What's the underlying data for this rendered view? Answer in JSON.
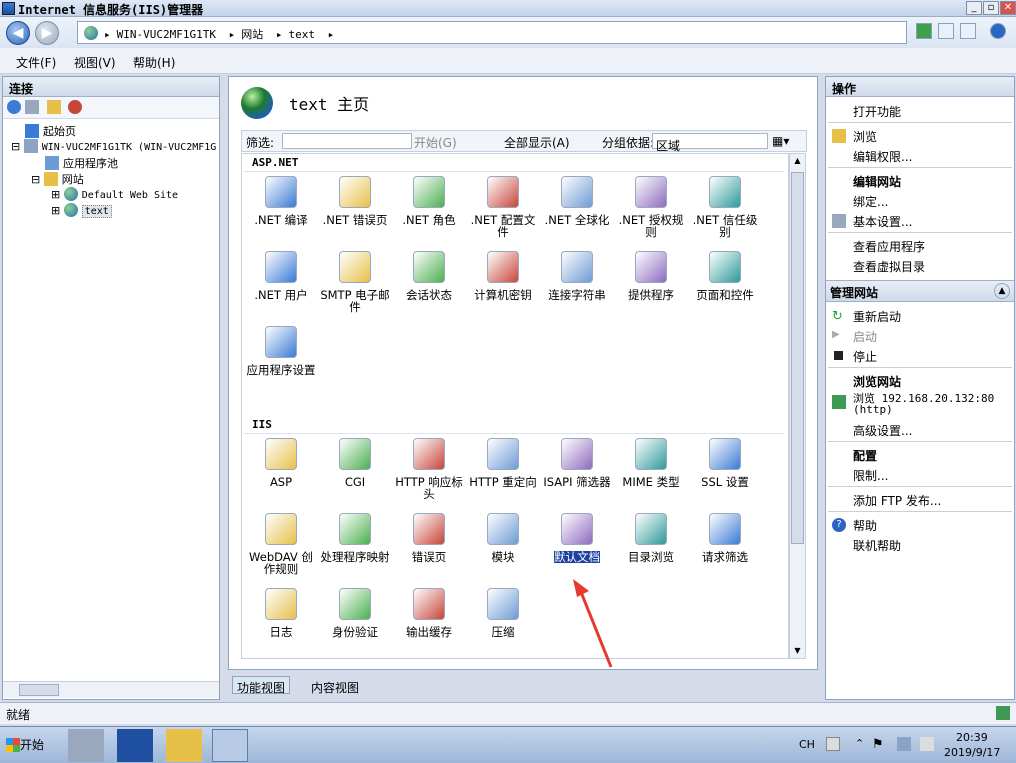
{
  "window": {
    "title": "Internet 信息服务(IIS)管理器"
  },
  "address": {
    "crumbs": [
      "WIN-VUC2MF1G1TK",
      "网站",
      "text"
    ]
  },
  "menu": [
    "文件(F)",
    "视图(V)",
    "帮助(H)"
  ],
  "left_pane": {
    "header": "连接",
    "tree": [
      {
        "label": "起始页"
      },
      {
        "label": "WIN-VUC2MF1G1TK (WIN-VUC2MF1G"
      },
      {
        "label": "应用程序池"
      },
      {
        "label": "网站"
      },
      {
        "label": "Default Web Site"
      },
      {
        "label": "text"
      }
    ]
  },
  "center": {
    "title": "text 主页",
    "filter": {
      "label": "筛选:",
      "start": "开始(G)",
      "show_all": "全部显示(A)",
      "group_by": "分组依据:",
      "group_value": "区域"
    },
    "sections": [
      {
        "name": "ASP.NET",
        "items": [
          {
            "label": ".NET 编译",
            "icon": "dotnet-compile-icon"
          },
          {
            "label": ".NET 错误页",
            "icon": "error-404-icon"
          },
          {
            "label": ".NET 角色",
            "icon": "roles-icon"
          },
          {
            "label": ".NET 配置文件",
            "icon": "profile-icon"
          },
          {
            "label": ".NET 全球化",
            "icon": "globalization-icon"
          },
          {
            "label": ".NET 授权规则",
            "icon": "authorization-icon"
          },
          {
            "label": ".NET 信任级别",
            "icon": "trust-level-icon"
          },
          {
            "label": ".NET 用户",
            "icon": "users-icon"
          },
          {
            "label": "SMTP 电子邮件",
            "icon": "smtp-email-icon"
          },
          {
            "label": "会话状态",
            "icon": "session-state-icon"
          },
          {
            "label": "计算机密钥",
            "icon": "machine-key-icon"
          },
          {
            "label": "连接字符串",
            "icon": "connection-strings-icon"
          },
          {
            "label": "提供程序",
            "icon": "providers-icon"
          },
          {
            "label": "页面和控件",
            "icon": "pages-controls-icon"
          },
          {
            "label": "应用程序设置",
            "icon": "app-settings-icon"
          }
        ]
      },
      {
        "name": "IIS",
        "items": [
          {
            "label": "ASP",
            "icon": "asp-icon"
          },
          {
            "label": "CGI",
            "icon": "cgi-icon"
          },
          {
            "label": "HTTP 响应标头",
            "icon": "http-response-headers-icon"
          },
          {
            "label": "HTTP 重定向",
            "icon": "http-redirect-icon"
          },
          {
            "label": "ISAPI 筛选器",
            "icon": "isapi-filters-icon"
          },
          {
            "label": "MIME 类型",
            "icon": "mime-types-icon"
          },
          {
            "label": "SSL 设置",
            "icon": "ssl-lock-icon"
          },
          {
            "label": "WebDAV 创作规则",
            "icon": "webdav-icon"
          },
          {
            "label": "处理程序映射",
            "icon": "handler-mappings-icon"
          },
          {
            "label": "错误页",
            "icon": "error-pages-icon"
          },
          {
            "label": "模块",
            "icon": "modules-icon"
          },
          {
            "label": "默认文档",
            "icon": "default-document-icon"
          },
          {
            "label": "目录浏览",
            "icon": "directory-browsing-icon"
          },
          {
            "label": "请求筛选",
            "icon": "request-filtering-icon"
          },
          {
            "label": "日志",
            "icon": "logging-icon"
          },
          {
            "label": "身份验证",
            "icon": "authentication-icon"
          },
          {
            "label": "输出缓存",
            "icon": "output-caching-icon"
          },
          {
            "label": "压缩",
            "icon": "compression-icon"
          }
        ]
      }
    ],
    "tabs": [
      "功能视图",
      "内容视图"
    ]
  },
  "right_pane": {
    "header": "操作",
    "open_feature": "打开功能",
    "browse": "浏览",
    "edit_perms": "编辑权限...",
    "edit_site_hdr": "编辑网站",
    "bindings": "绑定...",
    "basic_settings": "基本设置...",
    "view_apps": "查看应用程序",
    "view_vdirs": "查看虚拟目录",
    "manage_site_hdr": "管理网站",
    "restart": "重新启动",
    "start": "启动",
    "stop": "停止",
    "browse_site_hdr": "浏览网站",
    "browse_url": "浏览 192.168.20.132:80",
    "browse_proto": "(http)",
    "advanced": "高级设置...",
    "config_hdr": "配置",
    "limits": "限制...",
    "add_ftp": "添加 FTP 发布...",
    "help": "帮助",
    "online_help": "联机帮助"
  },
  "status": {
    "text": "就绪"
  },
  "taskbar": {
    "start": "开始",
    "lang": "CH",
    "time": "20:39",
    "date": "2019/9/17"
  }
}
